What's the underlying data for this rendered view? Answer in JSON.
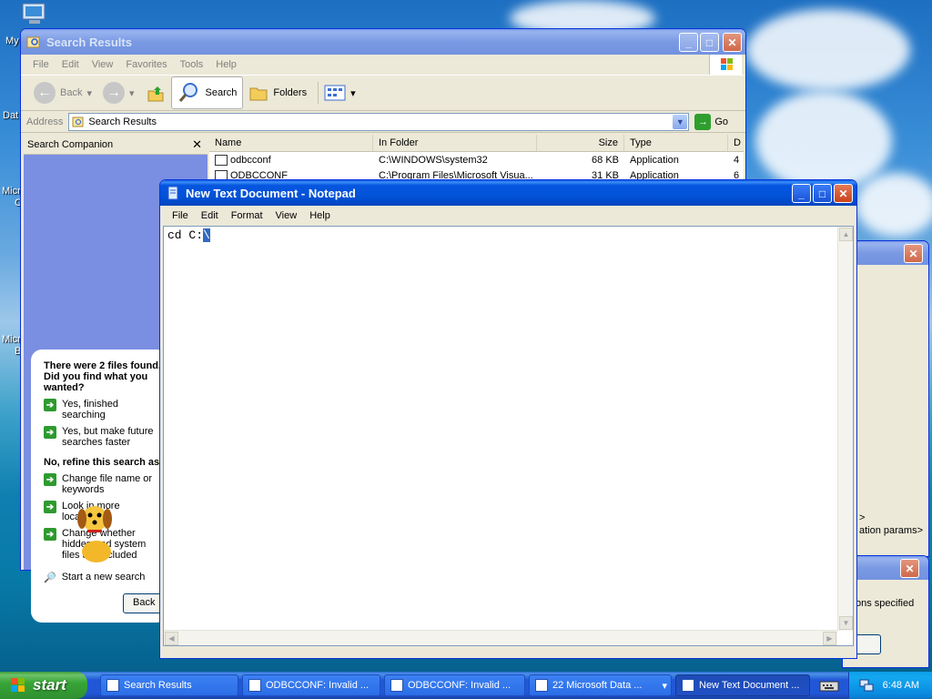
{
  "desktop": {
    "icon_labels": [
      "My",
      "Dat",
      "Micr",
      "C",
      "Micr",
      "B"
    ]
  },
  "search_window": {
    "title": "Search Results",
    "menu": [
      "File",
      "Edit",
      "View",
      "Favorites",
      "Tools",
      "Help"
    ],
    "toolbar": {
      "back": "Back",
      "search": "Search",
      "folders": "Folders"
    },
    "address": {
      "label": "Address",
      "value": "Search Results",
      "go": "Go"
    },
    "companion": {
      "title": "Search Companion",
      "heading": "There were 2 files found. Did you find what you wanted?",
      "options": [
        "Yes, finished searching",
        "Yes, but make future searches faster"
      ],
      "refine_heading": "No, refine this search as",
      "refine_options": [
        "Change file name or keywords",
        "Look in more locations",
        "Change whether hidden and system files are included"
      ],
      "new_search": "Start a new search",
      "back_button": "Back"
    },
    "columns": [
      "Name",
      "In Folder",
      "Size",
      "Type",
      "D"
    ],
    "rows": [
      {
        "name": "odbcconf",
        "folder": "C:\\WINDOWS\\system32",
        "size": "68 KB",
        "type": "Application",
        "d": "4"
      },
      {
        "name": "ODBCCONF",
        "folder": "C:\\Program Files\\Microsoft Visua...",
        "size": "31 KB",
        "type": "Application",
        "d": "6"
      }
    ]
  },
  "notepad": {
    "title": "New Text Document - Notepad",
    "menu": [
      "File",
      "Edit",
      "Format",
      "View",
      "Help"
    ],
    "text_plain": "cd C:",
    "text_selected": "\\"
  },
  "background_window": {
    "text_1": ">",
    "text_2": "ation params>",
    "text_3": "ons specified"
  },
  "taskbar": {
    "start": "start",
    "tasks": [
      "Search Results",
      "ODBCCONF: Invalid ...",
      "ODBCCONF: Invalid ...",
      "22 Microsoft Data ...",
      "New Text Document ..."
    ],
    "clock": "6:48 AM"
  }
}
